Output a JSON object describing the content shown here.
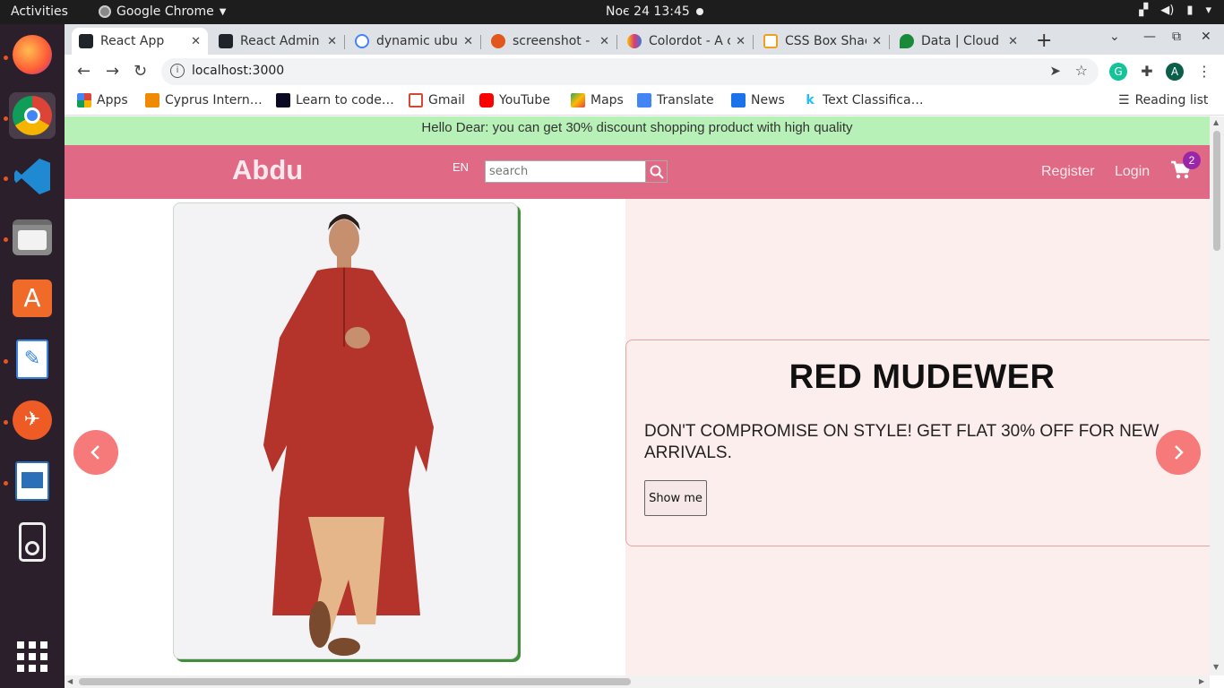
{
  "system": {
    "activities": "Activities",
    "app_name": "Google Chrome",
    "clock": "Noє 24  13:45"
  },
  "dock": {
    "items": [
      "firefox-icon",
      "chrome-icon",
      "vscode-icon",
      "files-icon",
      "software-center-icon",
      "text-editor-icon",
      "postman-icon",
      "writer-icon",
      "sd-card-icon",
      "app-grid-icon"
    ]
  },
  "tabs": [
    {
      "label": "React App",
      "color": "#20232a"
    },
    {
      "label": "React Admin",
      "color": "#20232a"
    },
    {
      "label": "dynamic ubu",
      "color": "#ffffff"
    },
    {
      "label": "screenshot -",
      "color": "#e2571e"
    },
    {
      "label": "Colordot - A c",
      "color": "#d83a7a"
    },
    {
      "label": "CSS Box Shac",
      "color": "#f0a020"
    },
    {
      "label": "Data | Cloud",
      "color": "#1a8a3a"
    }
  ],
  "toolbar": {
    "url": "localhost:3000",
    "profile_initial": "A"
  },
  "bookmarks": {
    "items": [
      "Apps",
      "Cyprus Intern…",
      "Learn to code…",
      "Gmail",
      "YouTube",
      "Maps",
      "Translate",
      "News",
      "Text Classifica…"
    ],
    "reading_list": "Reading list"
  },
  "page": {
    "announcement": "Hello Dear: you can get 30% discount shopping product with high quality",
    "logo": "Abdu",
    "language": "EN",
    "search_placeholder": "search",
    "register": "Register",
    "login": "Login",
    "cart_count": "2",
    "slide": {
      "title": "RED MUDEWER",
      "description": "DON'T COMPROMISE ON STYLE! GET FLAT 30% OFF FOR NEW ARRIVALS.",
      "button": "Show me"
    },
    "colors": {
      "navbar": "#e06a85",
      "announcement_bg": "#b8f1b7",
      "slide_bg": "#fdeeee",
      "arrow": "#f77a7a"
    }
  }
}
